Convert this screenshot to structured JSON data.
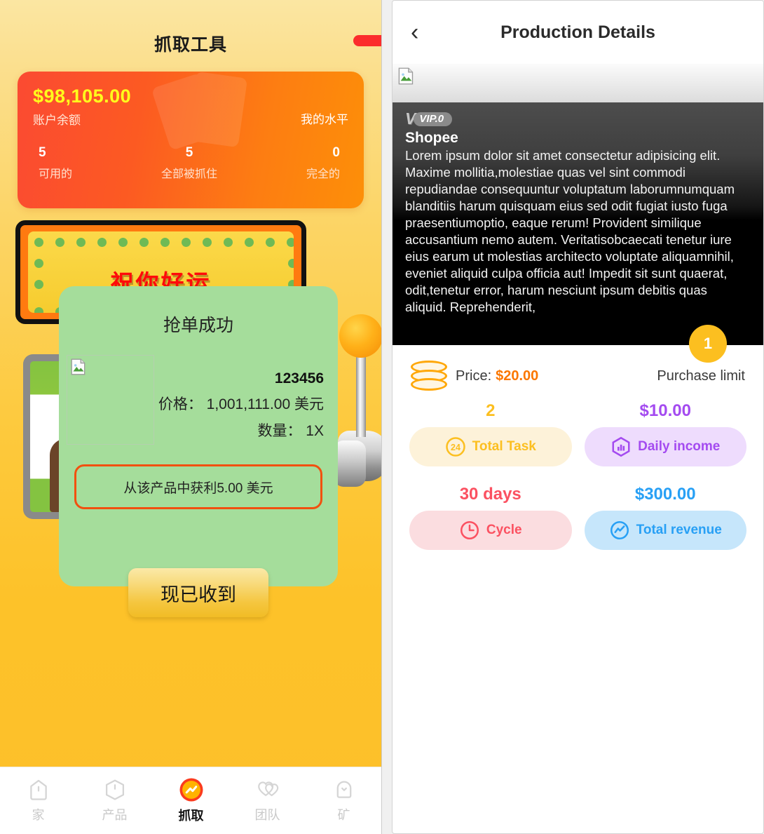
{
  "left": {
    "title": "抓取工具",
    "balance": {
      "amount": "$98,105.00",
      "amount_label": "账户余额",
      "level_label": "我的水平",
      "stats": [
        {
          "value": "5",
          "label": "可用的"
        },
        {
          "value": "5",
          "label": "全部被抓住"
        },
        {
          "value": "0",
          "label": "完全的"
        }
      ]
    },
    "marquee": {
      "text": "祝你好运"
    },
    "nav": [
      {
        "icon": "home-icon",
        "label": "家",
        "active": false
      },
      {
        "icon": "box-icon",
        "label": "产品",
        "active": false
      },
      {
        "icon": "claw-icon",
        "label": "抓取",
        "active": true
      },
      {
        "icon": "team-icon",
        "label": "团队",
        "active": false
      },
      {
        "icon": "mine-icon",
        "label": "矿",
        "active": false
      }
    ]
  },
  "modal": {
    "title": "抢单成功",
    "thumb_icon": "broken-image-icon",
    "code": "123456",
    "price_line": "价格： 1,001,111.00 美元",
    "qty_line": "数量： 1X",
    "profit_text": "从该产品中获利5.00 美元",
    "confirm_label": "现已收到"
  },
  "right": {
    "back_icon": "chevron-left-icon",
    "title": "Production Details",
    "banner_icon": "broken-image-icon",
    "vip": {
      "v": "V",
      "pill": "VIP.0"
    },
    "brand": "Shopee",
    "description": "Lorem ipsum dolor sit amet consectetur adipisicing elit. Maxime mollitia,molestiae quas vel sint commodi repudiandae consequuntur voluptatum laborumnumquam blanditiis harum quisquam eius sed odit fugiat iusto fuga praesentiumoptio, eaque rerum! Provident similique accusantium nemo autem. Veritatisobcaecati tenetur iure eius earum ut molestias architecto voluptate aliquamnihil, eveniet aliquid culpa officia aut! Impedit sit sunt quaerat, odit,tenetur error, harum nesciunt ipsum debitis quas aliquid. Reprehenderit,",
    "purchase_limit_badge": "1",
    "price_label": "Price:",
    "price_value": "$20.00",
    "limit_label": "Purchase limit",
    "stats": [
      {
        "value": "2",
        "label": "Total Task",
        "icon": "task-24-icon",
        "color": "#fcbf20",
        "bg": "#fdf2d9"
      },
      {
        "value": "$10.00",
        "label": "Daily income",
        "icon": "chart-bar-icon",
        "color": "#a44bf0",
        "bg": "#eedcfd"
      },
      {
        "value": "30 days",
        "label": "Cycle",
        "icon": "clock-icon",
        "color": "#fb5161",
        "bg": "#fbdde0"
      },
      {
        "value": "$300.00",
        "label": "Total revenue",
        "icon": "trend-up-icon",
        "color": "#28a0f5",
        "bg": "#c6e6fb"
      }
    ]
  }
}
